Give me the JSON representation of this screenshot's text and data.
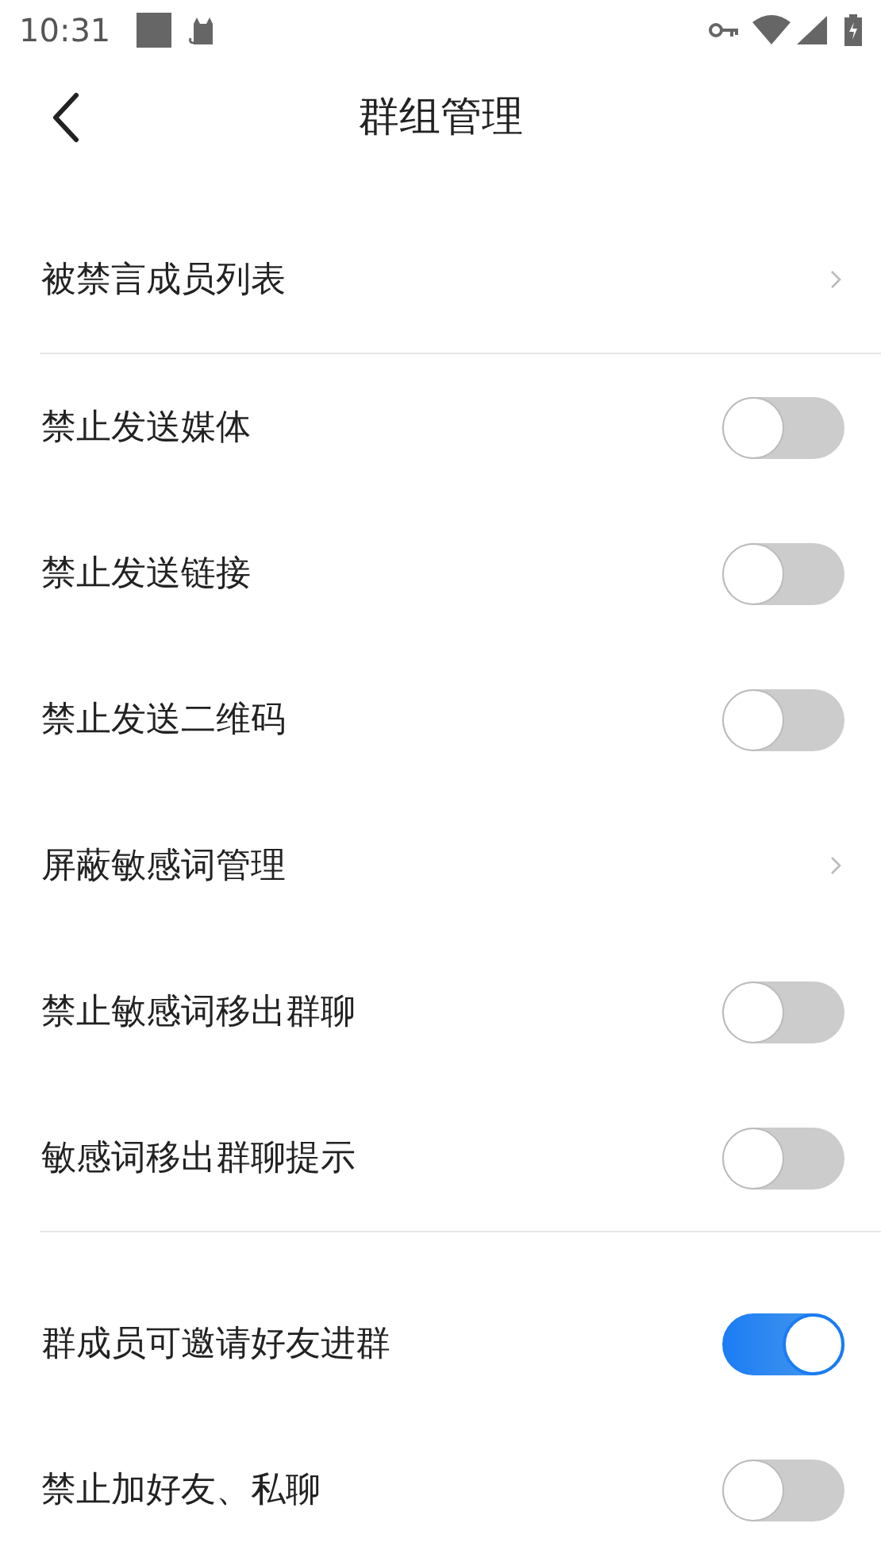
{
  "status_bar": {
    "time": "10:31"
  },
  "nav": {
    "title": "群组管理"
  },
  "sections": [
    {
      "items": [
        {
          "kind": "link",
          "label": "被禁言成员列表"
        }
      ]
    },
    {
      "items": [
        {
          "kind": "toggle",
          "label": "禁止发送媒体",
          "on": false
        },
        {
          "kind": "toggle",
          "label": "禁止发送链接",
          "on": false
        },
        {
          "kind": "toggle",
          "label": "禁止发送二维码",
          "on": false
        },
        {
          "kind": "link",
          "label": "屏蔽敏感词管理"
        },
        {
          "kind": "toggle",
          "label": "禁止敏感词移出群聊",
          "on": false
        },
        {
          "kind": "toggle",
          "label": "敏感词移出群聊提示",
          "on": false
        }
      ]
    },
    {
      "items": [
        {
          "kind": "toggle",
          "label": "群成员可邀请好友进群",
          "on": true
        },
        {
          "kind": "toggle",
          "label": "禁止加好友、私聊",
          "on": false
        }
      ]
    }
  ]
}
